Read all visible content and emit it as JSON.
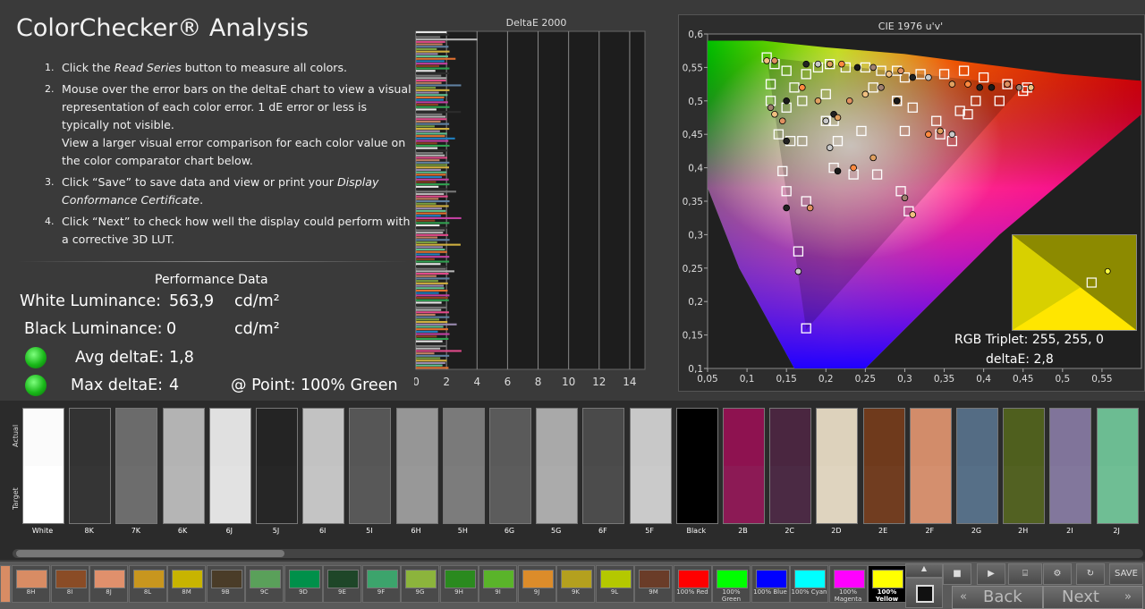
{
  "title": "ColorChecker® Analysis",
  "steps": [
    {
      "num": "1.",
      "parts": [
        "Click the ",
        {
          "i": "Read Series"
        },
        " button to measure all colors."
      ]
    },
    {
      "num": "2.",
      "parts": [
        "Mouse over the error bars on the deltaE chart to view a visual representation of each color error. 1 dE error or less is typically not visible.",
        {
          "br": true
        },
        "View a larger visual error comparison for each color value on the color comparator chart below."
      ]
    },
    {
      "num": "3.",
      "parts": [
        "Click “Save” to save data and view or print your ",
        {
          "i": "Display Conformance Certificate"
        },
        "."
      ]
    },
    {
      "num": "4.",
      "parts": [
        "Click “Next” to check how well the display could perform with a corrective 3D LUT."
      ]
    }
  ],
  "performance": {
    "title": "Performance Data",
    "white_label": "White Luminance:",
    "white_value": "563,9",
    "white_unit": "cd/m²",
    "black_label": "Black Luminance:",
    "black_value": "0",
    "black_unit": "cd/m²",
    "avg_label": "Avg deltaE:",
    "avg_value": "1,8",
    "max_label": "Max deltaE:",
    "max_value": "4",
    "point_label": "@ Point: 100% Green",
    "status_color": "#1fbf1f"
  },
  "deltaE_chart": {
    "title": "DeltaE 2000",
    "ticks": [
      "0",
      "2",
      "4",
      "6",
      "8",
      "10",
      "12",
      "14"
    ],
    "xlim": [
      0,
      15
    ],
    "bar_count": 140
  },
  "chart_data": {
    "type": "scatter",
    "title": "CIE 1976 u'v'",
    "xlabel": "",
    "ylabel": "",
    "x_ticks": [
      "0,05",
      "0,1",
      "0,15",
      "0,2",
      "0,25",
      "0,3",
      "0,35",
      "0,4",
      "0,45",
      "0,5",
      "0,55"
    ],
    "y_ticks": [
      "0,1",
      "0,15",
      "0,2",
      "0,25",
      "0,3",
      "0,35",
      "0,4",
      "0,45",
      "0,5",
      "0,55",
      "0,6"
    ],
    "xlim": [
      0.05,
      0.6
    ],
    "ylim": [
      0.1,
      0.6
    ],
    "targets": [
      [
        0.125,
        0.565
      ],
      [
        0.135,
        0.555
      ],
      [
        0.15,
        0.545
      ],
      [
        0.175,
        0.54
      ],
      [
        0.19,
        0.55
      ],
      [
        0.205,
        0.555
      ],
      [
        0.225,
        0.55
      ],
      [
        0.25,
        0.55
      ],
      [
        0.27,
        0.545
      ],
      [
        0.29,
        0.545
      ],
      [
        0.3,
        0.535
      ],
      [
        0.32,
        0.54
      ],
      [
        0.35,
        0.54
      ],
      [
        0.375,
        0.545
      ],
      [
        0.4,
        0.535
      ],
      [
        0.43,
        0.525
      ],
      [
        0.455,
        0.52
      ],
      [
        0.45,
        0.515
      ],
      [
        0.42,
        0.5
      ],
      [
        0.38,
        0.48
      ],
      [
        0.34,
        0.47
      ],
      [
        0.31,
        0.49
      ],
      [
        0.29,
        0.5
      ],
      [
        0.26,
        0.52
      ],
      [
        0.2,
        0.51
      ],
      [
        0.17,
        0.5
      ],
      [
        0.15,
        0.49
      ],
      [
        0.13,
        0.5
      ],
      [
        0.13,
        0.525
      ],
      [
        0.16,
        0.52
      ],
      [
        0.14,
        0.45
      ],
      [
        0.155,
        0.44
      ],
      [
        0.17,
        0.44
      ],
      [
        0.21,
        0.47
      ],
      [
        0.215,
        0.44
      ],
      [
        0.245,
        0.455
      ],
      [
        0.29,
        0.5
      ],
      [
        0.3,
        0.455
      ],
      [
        0.345,
        0.45
      ],
      [
        0.36,
        0.44
      ],
      [
        0.37,
        0.485
      ],
      [
        0.39,
        0.5
      ],
      [
        0.2,
        0.47
      ],
      [
        0.21,
        0.4
      ],
      [
        0.235,
        0.39
      ],
      [
        0.265,
        0.39
      ],
      [
        0.295,
        0.365
      ],
      [
        0.305,
        0.335
      ],
      [
        0.145,
        0.395
      ],
      [
        0.15,
        0.365
      ],
      [
        0.175,
        0.35
      ],
      [
        0.165,
        0.275
      ],
      [
        0.175,
        0.16
      ]
    ],
    "samples": [
      [
        0.125,
        0.56
      ],
      [
        0.135,
        0.56
      ],
      [
        0.175,
        0.555
      ],
      [
        0.19,
        0.555
      ],
      [
        0.205,
        0.555
      ],
      [
        0.22,
        0.555
      ],
      [
        0.24,
        0.55
      ],
      [
        0.26,
        0.55
      ],
      [
        0.28,
        0.54
      ],
      [
        0.295,
        0.545
      ],
      [
        0.31,
        0.535
      ],
      [
        0.33,
        0.535
      ],
      [
        0.36,
        0.525
      ],
      [
        0.38,
        0.525
      ],
      [
        0.41,
        0.52
      ],
      [
        0.445,
        0.52
      ],
      [
        0.46,
        0.52
      ],
      [
        0.43,
        0.525
      ],
      [
        0.395,
        0.52
      ],
      [
        0.36,
        0.45
      ],
      [
        0.345,
        0.455
      ],
      [
        0.33,
        0.45
      ],
      [
        0.29,
        0.5
      ],
      [
        0.27,
        0.52
      ],
      [
        0.25,
        0.51
      ],
      [
        0.23,
        0.5
      ],
      [
        0.21,
        0.48
      ],
      [
        0.2,
        0.47
      ],
      [
        0.215,
        0.475
      ],
      [
        0.17,
        0.52
      ],
      [
        0.15,
        0.5
      ],
      [
        0.13,
        0.49
      ],
      [
        0.135,
        0.48
      ],
      [
        0.145,
        0.47
      ],
      [
        0.15,
        0.44
      ],
      [
        0.205,
        0.43
      ],
      [
        0.26,
        0.415
      ],
      [
        0.235,
        0.4
      ],
      [
        0.215,
        0.395
      ],
      [
        0.3,
        0.355
      ],
      [
        0.31,
        0.33
      ],
      [
        0.18,
        0.34
      ],
      [
        0.15,
        0.34
      ],
      [
        0.165,
        0.245
      ],
      [
        0.19,
        0.5
      ]
    ],
    "inset": {
      "target": [
        0.4,
        0.5
      ],
      "sample": [
        0.55,
        0.38
      ]
    }
  },
  "cie_info": {
    "rgb_triplet": "RGB Triplet: 255, 255, 0",
    "deltaE": "deltaE: 2,8"
  },
  "swatch_axis": {
    "actual": "Actual",
    "target": "Target"
  },
  "swatches": [
    {
      "label": "White",
      "actual": "#fbfbfb",
      "target": "#ffffff"
    },
    {
      "label": "8K",
      "actual": "#333333",
      "target": "#353535"
    },
    {
      "label": "7K",
      "actual": "#6b6b6b",
      "target": "#6d6d6d"
    },
    {
      "label": "6K",
      "actual": "#b3b3b3",
      "target": "#b5b5b5"
    },
    {
      "label": "6J",
      "actual": "#e0e0e0",
      "target": "#e2e2e2"
    },
    {
      "label": "5J",
      "actual": "#242424",
      "target": "#262626"
    },
    {
      "label": "6I",
      "actual": "#c2c2c2",
      "target": "#c4c4c4"
    },
    {
      "label": "5I",
      "actual": "#565656",
      "target": "#585858"
    },
    {
      "label": "6H",
      "actual": "#969696",
      "target": "#989898"
    },
    {
      "label": "5H",
      "actual": "#7a7a7a",
      "target": "#7c7c7c"
    },
    {
      "label": "6G",
      "actual": "#5a5a5a",
      "target": "#5c5c5c"
    },
    {
      "label": "5G",
      "actual": "#a9a9a9",
      "target": "#ababab"
    },
    {
      "label": "6F",
      "actual": "#4a4a4a",
      "target": "#4c4c4c"
    },
    {
      "label": "5F",
      "actual": "#c8c8c8",
      "target": "#cacaca"
    },
    {
      "label": "Black",
      "actual": "#000000",
      "target": "#000000"
    },
    {
      "label": "2B",
      "actual": "#8e1250",
      "target": "#8c1a55"
    },
    {
      "label": "2C",
      "actual": "#4a2640",
      "target": "#4b2a44"
    },
    {
      "label": "2D",
      "actual": "#ddd2bc",
      "target": "#dfd4bf"
    },
    {
      "label": "2E",
      "actual": "#6f3a1c",
      "target": "#713d20"
    },
    {
      "label": "2F",
      "actual": "#d28c6a",
      "target": "#d48f6e"
    },
    {
      "label": "2G",
      "actual": "#546c84",
      "target": "#566f87"
    },
    {
      "label": "2H",
      "actual": "#4f5f1e",
      "target": "#526122"
    },
    {
      "label": "2I",
      "actual": "#80749a",
      "target": "#82779c"
    },
    {
      "label": "2J",
      "actual": "#6cbc92",
      "target": "#6fbe94"
    }
  ],
  "chips": [
    {
      "label": "8H",
      "color": "#d88c64"
    },
    {
      "label": "8I",
      "color": "#8a4c26"
    },
    {
      "label": "8J",
      "color": "#e0906c"
    },
    {
      "label": "8L",
      "color": "#c8961e"
    },
    {
      "label": "8M",
      "color": "#c8b400"
    },
    {
      "label": "9B",
      "color": "#4a3c28"
    },
    {
      "label": "9C",
      "color": "#5aa05a"
    },
    {
      "label": "9D",
      "color": "#00904a"
    },
    {
      "label": "9E",
      "color": "#1e4628"
    },
    {
      "label": "9F",
      "color": "#3ca46c"
    },
    {
      "label": "9G",
      "color": "#8cb43c"
    },
    {
      "label": "9H",
      "color": "#2a8a1e"
    },
    {
      "label": "9I",
      "color": "#5ab42a"
    },
    {
      "label": "9J",
      "color": "#dc8c2a"
    },
    {
      "label": "9K",
      "color": "#b4a01e"
    },
    {
      "label": "9L",
      "color": "#b4c800"
    },
    {
      "label": "9M",
      "color": "#6a3c28"
    },
    {
      "label": "100% Red",
      "color": "#ff0000"
    },
    {
      "label": "100% Green",
      "color": "#00ff00"
    },
    {
      "label": "100% Blue",
      "color": "#0000ff"
    },
    {
      "label": "100% Cyan",
      "color": "#00ffff"
    },
    {
      "label": "100% Magenta",
      "color": "#ff00ff"
    },
    {
      "label": "100% Yellow",
      "color": "#ffff00"
    }
  ],
  "buttons": {
    "save": "SAVE",
    "back": "Back",
    "next": "Next"
  }
}
